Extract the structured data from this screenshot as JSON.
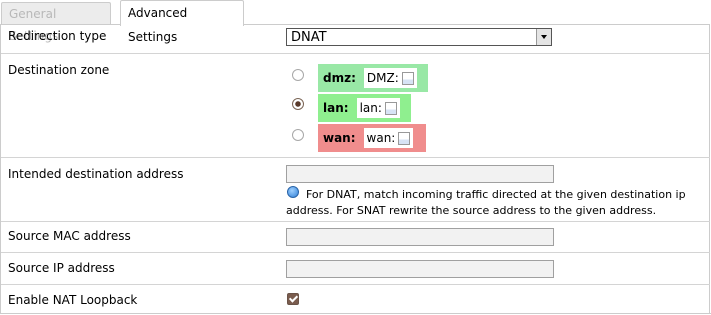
{
  "tabs": [
    {
      "label": "General Settings",
      "active": false
    },
    {
      "label": "Advanced Settings",
      "active": true
    }
  ],
  "fields": {
    "redirection_type": {
      "label": "Redirection type",
      "value": "DNAT"
    },
    "destination_zone": {
      "label": "Destination zone",
      "options": [
        {
          "zone": "dmz:",
          "network": "DMZ:",
          "color": "#99e8a6",
          "selected": false
        },
        {
          "zone": "lan:",
          "network": "lan:",
          "color": "#8fef8f",
          "selected": true
        },
        {
          "zone": "wan:",
          "network": "wan:",
          "color": "#f08d8d",
          "selected": false
        }
      ]
    },
    "intended_destination": {
      "label": "Intended destination address",
      "value": "",
      "hint": "For DNAT, match incoming traffic directed at the given destination ip address. For SNAT rewrite the source address to the given address."
    },
    "source_mac": {
      "label": "Source MAC address",
      "value": ""
    },
    "source_ip": {
      "label": "Source IP address",
      "value": ""
    },
    "nat_loopback": {
      "label": "Enable NAT Loopback",
      "checked": true
    }
  },
  "icons": {
    "info": "info-icon",
    "network": "network-icon",
    "dropdown": "chevron-down-icon"
  }
}
